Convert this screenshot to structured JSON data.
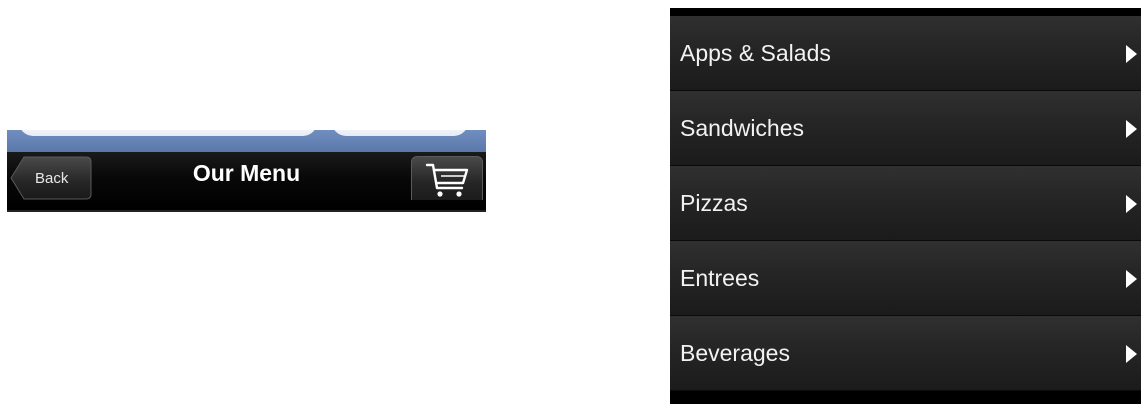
{
  "navbar": {
    "back_label": "Back",
    "title": "Our Menu",
    "cart_icon": "shopping-cart-icon"
  },
  "menu": {
    "items": [
      {
        "label": "Apps & Salads",
        "icon": "chevron-right-icon"
      },
      {
        "label": "Sandwiches",
        "icon": "chevron-right-icon"
      },
      {
        "label": "Pizzas",
        "icon": "chevron-right-icon"
      },
      {
        "label": "Entrees",
        "icon": "chevron-right-icon"
      },
      {
        "label": "Beverages",
        "icon": "chevron-right-icon"
      }
    ]
  },
  "colors": {
    "nav_background": "#000000",
    "header_strip": "#6f8fbf",
    "menu_row": "#262626",
    "text": "#ffffff"
  }
}
